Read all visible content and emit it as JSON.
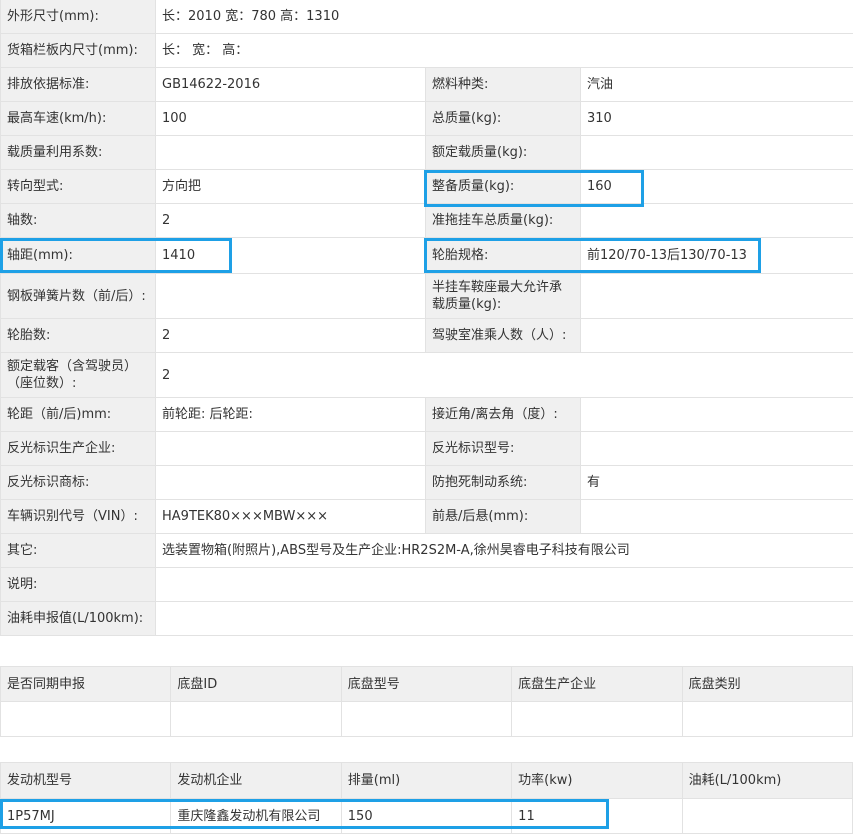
{
  "spec_rows": [
    {
      "l1": "外形尺寸(mm):",
      "v1": "长：2010 宽：780 高：1310",
      "full": true,
      "h": 34
    },
    {
      "l1": "货箱栏板内尺寸(mm):",
      "v1": "长： 宽： 高：",
      "full": true,
      "h": 34
    },
    {
      "l1": "排放依据标准:",
      "v1": "GB14622-2016",
      "l2": "燃料种类:",
      "v2": "汽油",
      "h": 34
    },
    {
      "l1": "最高车速(km/h):",
      "v1": "100",
      "l2": "总质量(kg):",
      "v2": "310",
      "h": 34
    },
    {
      "l1": "载质量利用系数:",
      "v1": "",
      "l2": "额定载质量(kg):",
      "v2": "",
      "h": 34
    },
    {
      "l1": "转向型式:",
      "v1": "方向把",
      "l2": "整备质量(kg):",
      "v2": "160",
      "h": 34
    },
    {
      "l1": "轴数:",
      "v1": "2",
      "l2": "准拖挂车总质量(kg):",
      "v2": "",
      "h": 34
    },
    {
      "l1": "轴距(mm):",
      "v1": "1410",
      "l2": "轮胎规格:",
      "v2": "前120/70-13后130/70-13",
      "h": 36
    },
    {
      "l1": "钢板弹簧片数（前/后）:",
      "v1": "",
      "l2": "半挂车鞍座最大允许承载质量(kg):",
      "v2": "",
      "h": 45
    },
    {
      "l1": "轮胎数:",
      "v1": "2",
      "l2": "驾驶室准乘人数（人）:",
      "v2": "",
      "h": 34
    },
    {
      "l1": "额定载客（含驾驶员）（座位数）:",
      "v1": "2",
      "full": true,
      "h": 45
    },
    {
      "l1": "轮距（前/后)mm:",
      "v1": "前轮距: 后轮距:",
      "l2": "接近角/离去角（度）:",
      "v2": "",
      "h": 34
    },
    {
      "l1": "反光标识生产企业:",
      "v1": "",
      "l2": "反光标识型号:",
      "v2": "",
      "h": 34
    },
    {
      "l1": "反光标识商标:",
      "v1": "",
      "l2": "防抱死制动系统:",
      "v2": "有",
      "h": 34
    },
    {
      "l1": "车辆识别代号（VIN）:",
      "v1": "HA9TEK80×××MBW×××",
      "l2": "前悬/后悬(mm):",
      "v2": "",
      "h": 34
    },
    {
      "l1": "其它:",
      "v1": "选装置物箱(附照片),ABS型号及生产企业:HR2S2M-A,徐州昊睿电子科技有限公司",
      "full": true,
      "h": 34
    },
    {
      "l1": "说明:",
      "v1": "",
      "full": true,
      "h": 34
    },
    {
      "l1": "油耗申报值(L/100km):",
      "v1": "",
      "full": true,
      "h": 34
    }
  ],
  "chassis": {
    "headers": [
      "是否同期申报",
      "底盘ID",
      "底盘型号",
      "底盘生产企业",
      "底盘类别"
    ],
    "row": [
      "",
      "",
      "",
      "",
      ""
    ]
  },
  "engine": {
    "headers": [
      "发动机型号",
      "发动机企业",
      "排量(ml)",
      "功率(kw)",
      "油耗(L/100km)"
    ],
    "row": [
      "1P57MJ",
      "重庆隆鑫发动机有限公司",
      "150",
      "11",
      ""
    ]
  },
  "highlight_color": "#1ea0e6"
}
